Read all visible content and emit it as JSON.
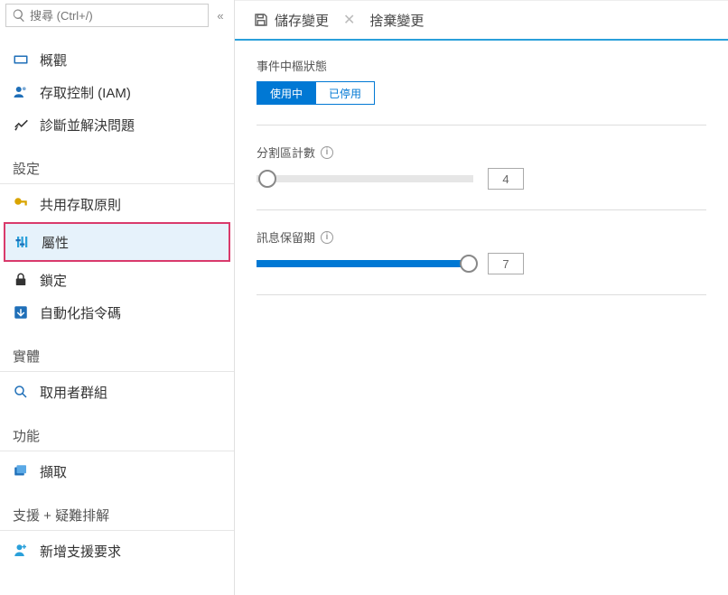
{
  "search": {
    "placeholder": "搜尋 (Ctrl+/)"
  },
  "toolbar": {
    "save": "儲存變更",
    "discard": "捨棄變更"
  },
  "sidebar": {
    "top": [
      {
        "label": "概觀"
      },
      {
        "label": "存取控制 (IAM)"
      },
      {
        "label": "診斷並解決問題"
      }
    ],
    "sections": {
      "settings": {
        "title": "設定",
        "items": [
          {
            "label": "共用存取原則"
          },
          {
            "label": "屬性",
            "selected": true
          },
          {
            "label": "鎖定"
          },
          {
            "label": "自動化指令碼"
          }
        ]
      },
      "entities": {
        "title": "實體",
        "items": [
          {
            "label": "取用者群組"
          }
        ]
      },
      "feature": {
        "title": "功能",
        "items": [
          {
            "label": "擷取"
          }
        ]
      },
      "support": {
        "title": "支援 + 疑難排解",
        "items": [
          {
            "label": "新增支援要求"
          }
        ]
      }
    }
  },
  "content": {
    "status": {
      "label": "事件中樞狀態",
      "active": "使用中",
      "disabled": "已停用"
    },
    "partition": {
      "label": "分割區計數",
      "value": "4",
      "fillPct": "width:0%",
      "thumbPct": "left:5%"
    },
    "retention": {
      "label": "訊息保留期",
      "value": "7",
      "fillPct": "width:98%",
      "thumbPct": "left:98%"
    }
  }
}
